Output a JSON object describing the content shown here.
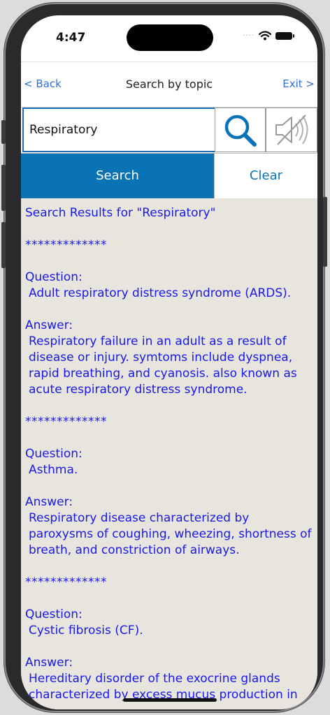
{
  "status": {
    "time": "4:47"
  },
  "nav": {
    "back": "< Back",
    "title": "Search by topic",
    "exit": "Exit >"
  },
  "search": {
    "value": "Respiratory",
    "search_label": "Search",
    "clear_label": "Clear"
  },
  "results": {
    "heading": "Search Results for  \"Respiratory\"",
    "separator": "*************",
    "entries": [
      {
        "question_label": "Question:",
        "question": "Adult respiratory distress syndrome (ARDS).",
        "answer_label": "Answer:",
        "answer": "Respiratory failure in an adult as a result of disease or injury. symtoms include dyspnea, rapid breathing, and cyanosis.  also known as acute respiratory distress syndrome."
      },
      {
        "question_label": "Question:",
        "question": "Asthma.",
        "answer_label": "Answer:",
        "answer": "Respiratory disease characterized by paroxysms of coughing, wheezing, shortness of breath, and constriction of airways."
      },
      {
        "question_label": "Question:",
        "question": "Cystic fibrosis (CF).",
        "answer_label": "Answer:",
        "answer": "Hereditary disorder of the exocrine glands characterized by excess mucus production in"
      }
    ]
  },
  "icons": {
    "search": "magnifier-icon",
    "sound": "speaker-muted-icon"
  },
  "colors": {
    "accent": "#0a73b5",
    "link": "#2f6fde",
    "result_text": "#1919e6",
    "result_bg": "#e8e5df"
  }
}
